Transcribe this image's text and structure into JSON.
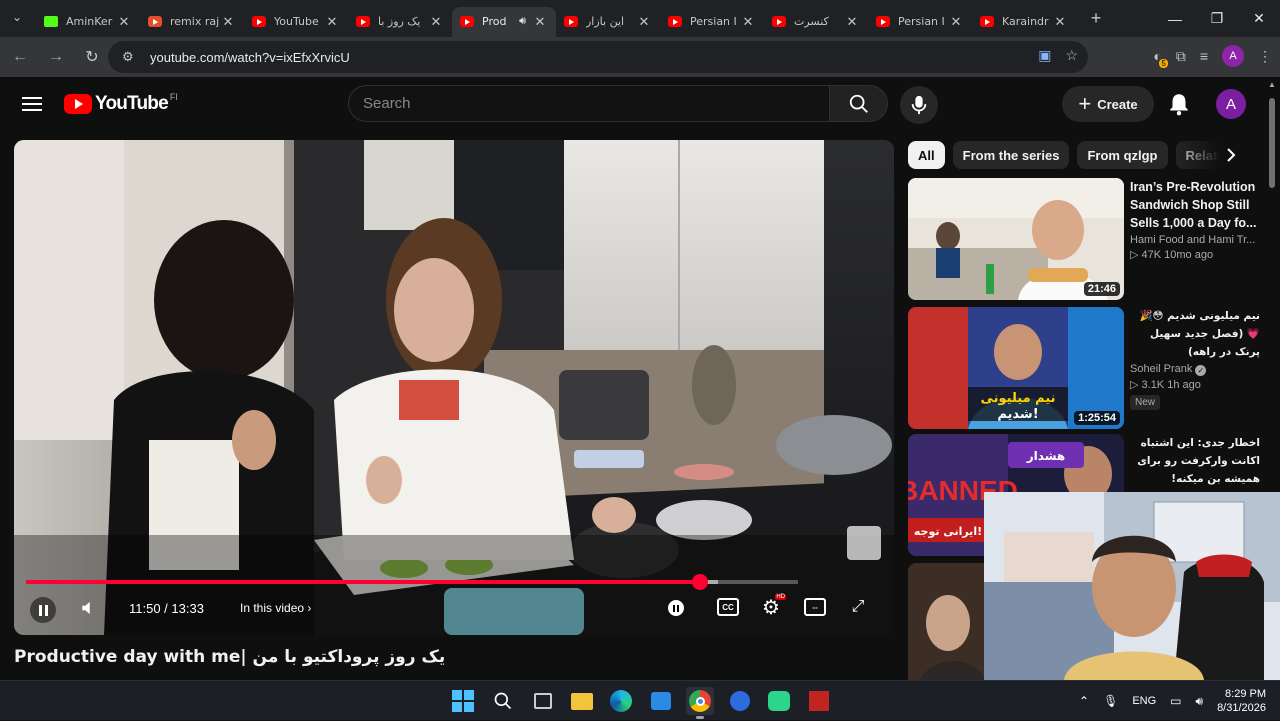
{
  "browser": {
    "tabs": [
      {
        "title": "AminKer",
        "icon": "kick-icon",
        "active": false
      },
      {
        "title": "remix raj",
        "icon": "reddit-like-icon",
        "active": false
      },
      {
        "title": "YouTube",
        "icon": "youtube-icon",
        "active": false
      },
      {
        "title": "یک روز با",
        "icon": "youtube-icon",
        "active": false
      },
      {
        "title": "Prod",
        "icon": "youtube-icon",
        "active": true
      },
      {
        "title": "این بازار",
        "icon": "youtube-icon",
        "active": false
      },
      {
        "title": "Persian I",
        "icon": "youtube-icon",
        "active": false
      },
      {
        "title": "کنسرت",
        "icon": "youtube-icon",
        "active": false
      },
      {
        "title": "Persian I",
        "icon": "youtube-icon",
        "active": false
      },
      {
        "title": "Karaindr",
        "icon": "youtube-icon",
        "active": false
      }
    ],
    "url": "youtube.com/watch?v=ixEfxXrvicU",
    "profile_initial": "A",
    "extension_badge": "5"
  },
  "yt": {
    "logo_text": "YouTube",
    "country_code": "FI",
    "search_placeholder": "Search",
    "create_label": "Create",
    "avatar_initial": "A"
  },
  "player": {
    "time": "11:50 / 13:33",
    "chapter_label": "In this video",
    "progress": 0.8727,
    "buffered": 0.897,
    "hd_badge": "HD"
  },
  "video_title": "Productive day with me| یک روز پروداکتیو با من",
  "chips": [
    "All",
    "From the series",
    "From qzlgp",
    "Relate"
  ],
  "recommendations": [
    {
      "title": "Iran’s Pre-Revolution Sandwich Shop Still Sells 1,000 a Day fo...",
      "channel": "Hami Food and Hami Tr...",
      "meta": "▷ 47K  10mo ago",
      "duration": "21:46",
      "rtl": false,
      "verified": false,
      "badge": ""
    },
    {
      "title": "نیم میلیونی شدیم 😳🎉💗 (فصل جدید سهیل پرنک در راهه)",
      "channel": "Soheil Prank",
      "meta": "▷ 3.1K  1h ago",
      "duration": "1:25:54",
      "rtl": true,
      "verified": true,
      "badge": "New"
    },
    {
      "title": "اخطار جدی: این اشتباه اکانت وارکرفت رو برای همیشه بن میکنه!",
      "channel": "",
      "meta": "",
      "duration": "",
      "rtl": true,
      "verified": false,
      "badge": ""
    }
  ],
  "taskbar": {
    "language": "ENG",
    "time": "8:29 PM",
    "date": "8/31/2026"
  },
  "colors": {
    "yt_red": "#ff0033",
    "background": "#0f0f0f",
    "chip_bg": "#272727"
  }
}
